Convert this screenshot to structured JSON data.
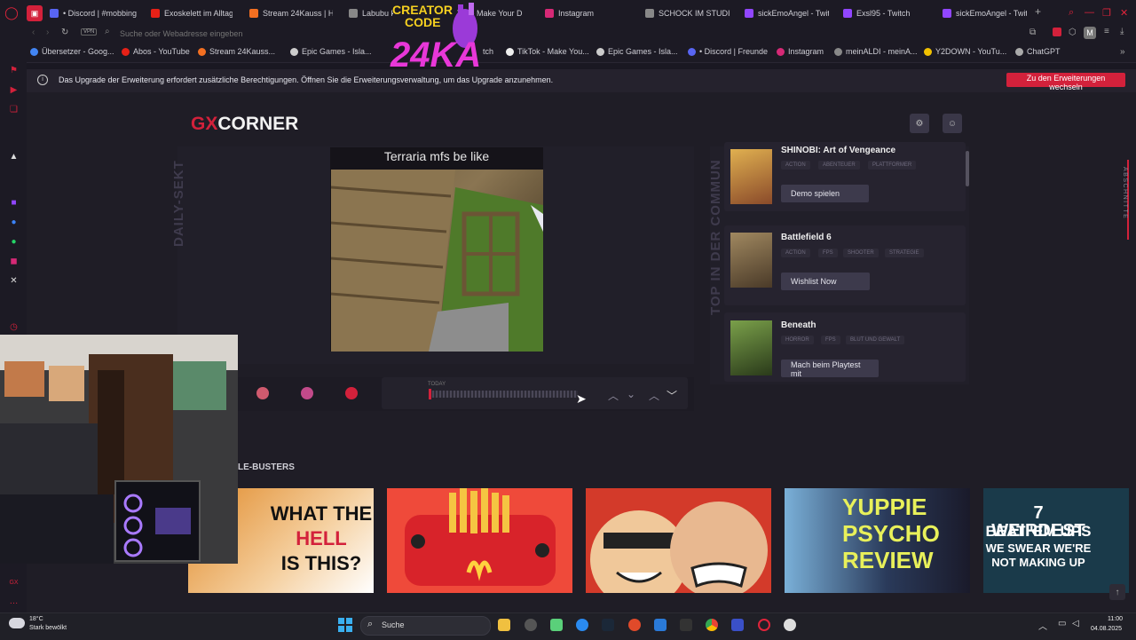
{
  "tabs": [
    {
      "label": "• Discord | #mobbing",
      "color": "#5865f2"
    },
    {
      "label": "Exoskelett im Alltag",
      "color": "#e62117"
    },
    {
      "label": "Stream 24Kauss | Ho",
      "color": "#f36f21"
    },
    {
      "label": "Labubu ka",
      "color": "#888888"
    },
    {
      "label": "Tok - Make Your D",
      "color": "#000000"
    },
    {
      "label": "Instagram",
      "color": "#d62976"
    },
    {
      "label": "SCHOCK IM STUDIO",
      "color": "#888888"
    },
    {
      "label": "sickEmoAngel - Twit",
      "color": "#9146ff"
    },
    {
      "label": "Exsl95 - Twitch",
      "color": "#9146ff"
    },
    {
      "label": "sickEmoAngel - Twit",
      "color": "#9146ff"
    }
  ],
  "address": {
    "placeholder": "Suche oder Webadresse eingeben",
    "vpn": "VPN"
  },
  "bookmarks": [
    {
      "label": "Übersetzer - Goog...",
      "color": "#4285f4"
    },
    {
      "label": "Abos - YouTube",
      "color": "#e62117"
    },
    {
      "label": "Stream 24Kauss...",
      "color": "#f36f21"
    },
    {
      "label": "Epic Games - Isla...",
      "color": "#cccccc"
    },
    {
      "label": "tch",
      "color": "#9146ff"
    },
    {
      "label": "TikTok - Make You...",
      "color": "#111111"
    },
    {
      "label": "Epic Games - Isla...",
      "color": "#cccccc"
    },
    {
      "label": "• Discord | Freunde",
      "color": "#5865f2"
    },
    {
      "label": "Instagram",
      "color": "#d62976"
    },
    {
      "label": "meinALDI - meinA...",
      "color": "#888888"
    },
    {
      "label": "Y2DOWN - YouTu...",
      "color": "#f0c000"
    },
    {
      "label": "ChatGPT",
      "color": "#aaaaaa"
    }
  ],
  "notification": {
    "text": "Das Upgrade der Erweiterung erfordert zusätzliche Berechtigungen. Öffnen Sie die Erweiterungsverwaltung, um das Upgrade anzunehmen.",
    "button": "Zu den Erweiterungen wechseln"
  },
  "creator_code": {
    "line1": "CREATOR",
    "line2": "CODE",
    "line3": "24KA"
  },
  "logo": {
    "gx": "GX",
    "corner": "CORNER"
  },
  "daily": {
    "section_label": "DAILY-SEKT",
    "meme_title": "Terraria mfs be like",
    "timeline_label": "TODAY"
  },
  "community": {
    "section_label": "TOP IN DER COMMUN",
    "games": [
      {
        "title": "SHINOBI: Art of Vengeance",
        "tags": [
          "ACTION",
          "ABENTEUER",
          "PLATTFORMER"
        ],
        "button": "Demo spielen",
        "color": "#b88a2a"
      },
      {
        "title": "Battlefield 6",
        "tags": [
          "ACTION",
          "FPS",
          "SHOOTER",
          "STRATEGIE"
        ],
        "button": "Wishlist Now",
        "color": "#7a6a4a"
      },
      {
        "title": "Beneath",
        "tags": [
          "HORROR",
          "FPS",
          "BLUT UND GEWALT"
        ],
        "button": "Mach beim Playtest mit",
        "color": "#4a6a2a"
      }
    ]
  },
  "sidebar_section_label": "ABSCHNITTE",
  "videos": {
    "section_title": "LE-BUSTERS",
    "items": [
      {
        "line1": "WHAT THE",
        "line2": "HELL",
        "line3": "IS THIS?"
      },
      {
        "line1": "",
        "line2": "",
        "line3": ""
      },
      {
        "line1": "",
        "line2": "",
        "line3": ""
      },
      {
        "line1": "YUPPIE",
        "line2": "PSYCHO",
        "line3": "REVIEW"
      },
      {
        "line1": "7 WEIRDEST",
        "line2": "BEAT 'EM UPS",
        "line3": "WE SWEAR WE'RE",
        "line4": "NOT MAKING UP"
      }
    ]
  },
  "taskbar": {
    "temp": "18°C",
    "weather": "Stark bewölkt",
    "search": "Suche",
    "time": "11:00",
    "date": "04.08.2025"
  }
}
